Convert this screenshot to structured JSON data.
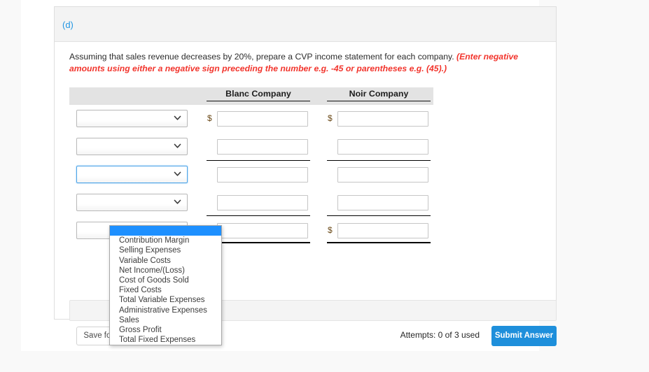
{
  "card": {
    "part_label": "(d)",
    "instruction_main": "Assuming that sales revenue decreases by 20%, prepare a CVP income statement for each company. ",
    "instruction_hint": "(Enter negative amounts using either a negative sign preceding the number e.g. -45 or parentheses e.g. (45).)"
  },
  "table": {
    "columns": [
      {
        "label": "Blanc Company"
      },
      {
        "label": "Noir Company"
      }
    ],
    "rows": [
      {
        "account_value": "",
        "blanc_value": "",
        "noir_value": "",
        "show_dollar": true,
        "rule": "none"
      },
      {
        "account_value": "",
        "blanc_value": "",
        "noir_value": "",
        "show_dollar": false,
        "rule": "none"
      },
      {
        "account_value": "",
        "blanc_value": "",
        "noir_value": "",
        "show_dollar": false,
        "rule": "single"
      },
      {
        "account_value": "",
        "blanc_value": "",
        "noir_value": "",
        "show_dollar": false,
        "rule": "single"
      },
      {
        "account_value": "",
        "blanc_value": "",
        "noir_value": "",
        "show_dollar": true,
        "rule": "double"
      }
    ]
  },
  "dropdown": {
    "open": true,
    "selected_value": "",
    "options": [
      "",
      "Contribution Margin",
      "Selling Expenses",
      "Variable Costs",
      "Net Income/(Loss)",
      "Cost of Goods Sold",
      "Fixed Costs",
      "Total Variable Expenses",
      "Administrative Expenses",
      "Sales",
      "Gross Profit",
      "Total Fixed Expenses"
    ]
  },
  "actions": {
    "save_later_label": "Save for Later",
    "attempts_text": "Attempts: 0 of 3 used",
    "submit_label": "Submit Answer"
  },
  "colors": {
    "accent_blue": "#1e8fdb",
    "part_label_blue": "#2196e3",
    "hint_red": "#f2342c",
    "header_gray": "#e3e3e3",
    "highlight_blue": "#1e90ff"
  }
}
